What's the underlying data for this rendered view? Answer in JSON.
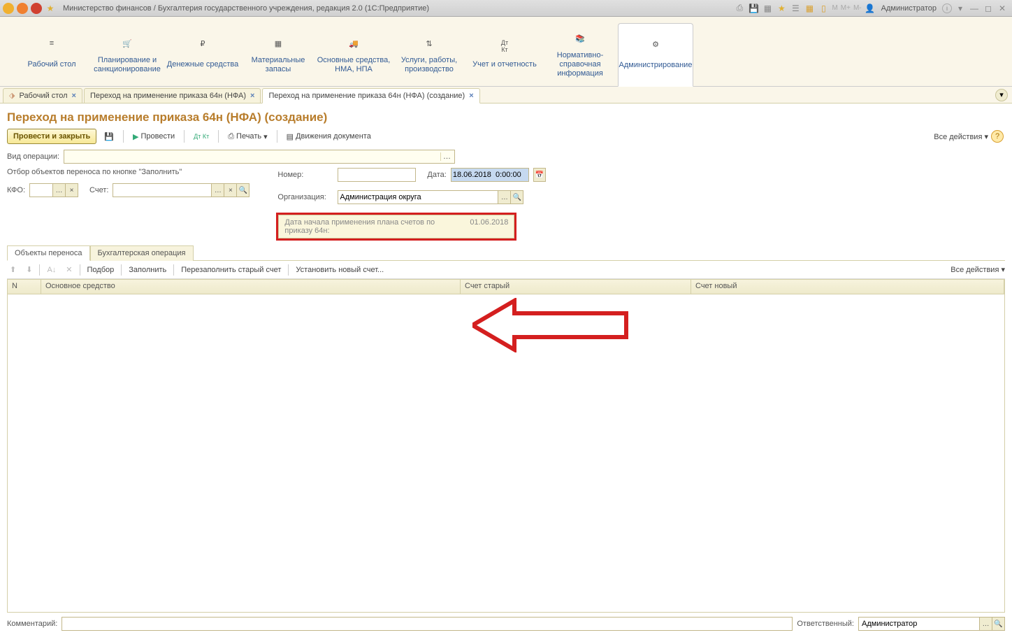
{
  "titlebar": {
    "title": "Министерство финансов / Бухгалтерия государственного учреждения, редакция 2.0  (1С:Предприятие)",
    "memory": [
      "M",
      "M+",
      "M-"
    ],
    "user": "Администратор"
  },
  "topnav": [
    {
      "label": "Рабочий стол"
    },
    {
      "label": "Планирование и санкционирование"
    },
    {
      "label": "Денежные средства"
    },
    {
      "label": "Материальные запасы"
    },
    {
      "label": "Основные средства, НМА, НПА"
    },
    {
      "label": "Услуги, работы, производство"
    },
    {
      "label": "Учет и отчетность"
    },
    {
      "label": "Нормативно-справочная информация"
    },
    {
      "label": "Администрирование"
    }
  ],
  "tabs": [
    {
      "label": "Рабочий стол"
    },
    {
      "label": "Переход на применение приказа 64н (НФА)"
    },
    {
      "label": "Переход на применение приказа 64н (НФА) (создание)"
    }
  ],
  "page": {
    "title": "Переход на применение приказа 64н (НФА) (создание)",
    "post_close": "Провести и закрыть",
    "post": "Провести",
    "print": "Печать",
    "movements": "Движения документа",
    "all_actions": "Все действия"
  },
  "form": {
    "vid_label": "Вид операции:",
    "filter_text": "Отбор объектов переноса по кнопке \"Заполнить\"",
    "kfo_label": "КФО:",
    "schet_label": "Счет:",
    "number_label": "Номер:",
    "date_label": "Дата:",
    "date_value": "18.06.2018  0:00:00",
    "org_label": "Организация:",
    "org_value": "Администрация округа",
    "start_date_label": "Дата начала применения плана счетов по приказу 64н:",
    "start_date_value": "01.06.2018"
  },
  "inner_tabs": [
    "Объекты переноса",
    "Бухгалтерская операция"
  ],
  "table_toolbar": {
    "pick": "Подбор",
    "fill": "Заполнить",
    "refill_old": "Перезаполнить старый счет",
    "set_new": "Установить новый счет...",
    "all_actions": "Все действия"
  },
  "table": {
    "col_n": "N",
    "col_asset": "Основное средство",
    "col_old": "Счет старый",
    "col_new": "Счет новый"
  },
  "bottom": {
    "comment_label": "Комментарий:",
    "resp_label": "Ответственный:",
    "resp_value": "Администратор"
  }
}
